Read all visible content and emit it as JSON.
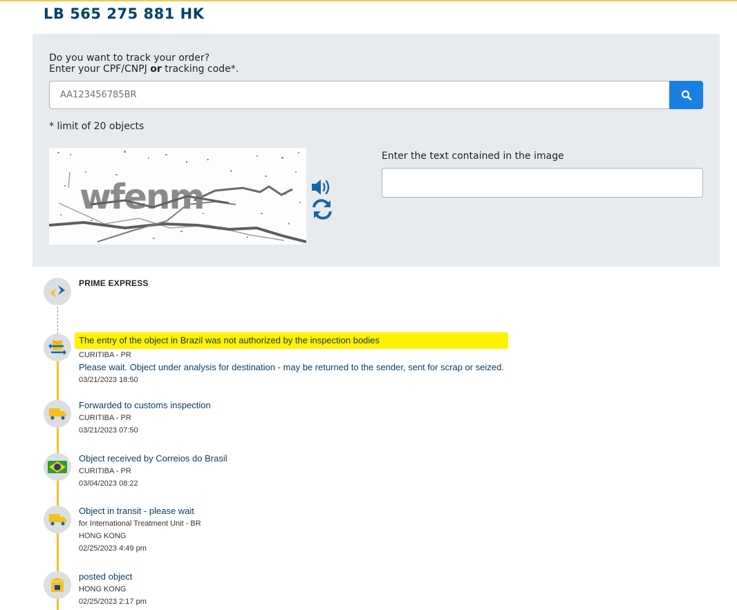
{
  "tracking_code": "LB 565 275 881 HK",
  "form": {
    "prompt_line1": "Do you want to track your order?",
    "prompt_line2_a": "Enter your CPF/CNPJ ",
    "prompt_line2_or": "or",
    "prompt_line2_b": " tracking code*.",
    "tracking_placeholder": "AA123456785BR",
    "tracking_value": "",
    "limit_note": "* limit of 20 objects",
    "captcha_text": "wfenm",
    "captcha_label": "Enter the text contained in the image",
    "captcha_value": ""
  },
  "icons": {
    "search": "search-icon",
    "audio": "speaker-icon",
    "refresh": "refresh-icon",
    "carrier": "prime-express-logo-icon",
    "returned": "returned-package-icon",
    "truck": "truck-icon",
    "flag": "brazil-flag-icon",
    "posted": "post-box-icon"
  },
  "colors": {
    "title": "#00416b",
    "search_button": "#1a7fe2",
    "timeline": "#f5c022",
    "highlight": "#fff200",
    "icon_blue": "#1565a6"
  },
  "events": [
    {
      "title": "PRIME EXPRESS"
    },
    {
      "title": "The entry of the object in Brazil was not authorized by the inspection bodies",
      "location": "CURITIBA - PR",
      "note": "Please wait. Object under analysis for destination - may be returned to the sender, sent for scrap or seized.",
      "datetime": "03/21/2023 18:50"
    },
    {
      "title": "Forwarded to customs inspection",
      "location": "CURITIBA - PR",
      "datetime": "03/21/2023 07:50"
    },
    {
      "title": "Object received by Correios do Brasil",
      "location": "CURITIBA - PR",
      "datetime": "03/04/2023 08:22"
    },
    {
      "title": "Object in transit - please wait",
      "detail": "for International Treatment Unit - BR",
      "location": "HONG KONG",
      "datetime": "02/25/2023 4:49 pm"
    },
    {
      "title": "posted object",
      "location": "HONG KONG",
      "datetime": "02/25/2023 2:17 pm"
    }
  ]
}
